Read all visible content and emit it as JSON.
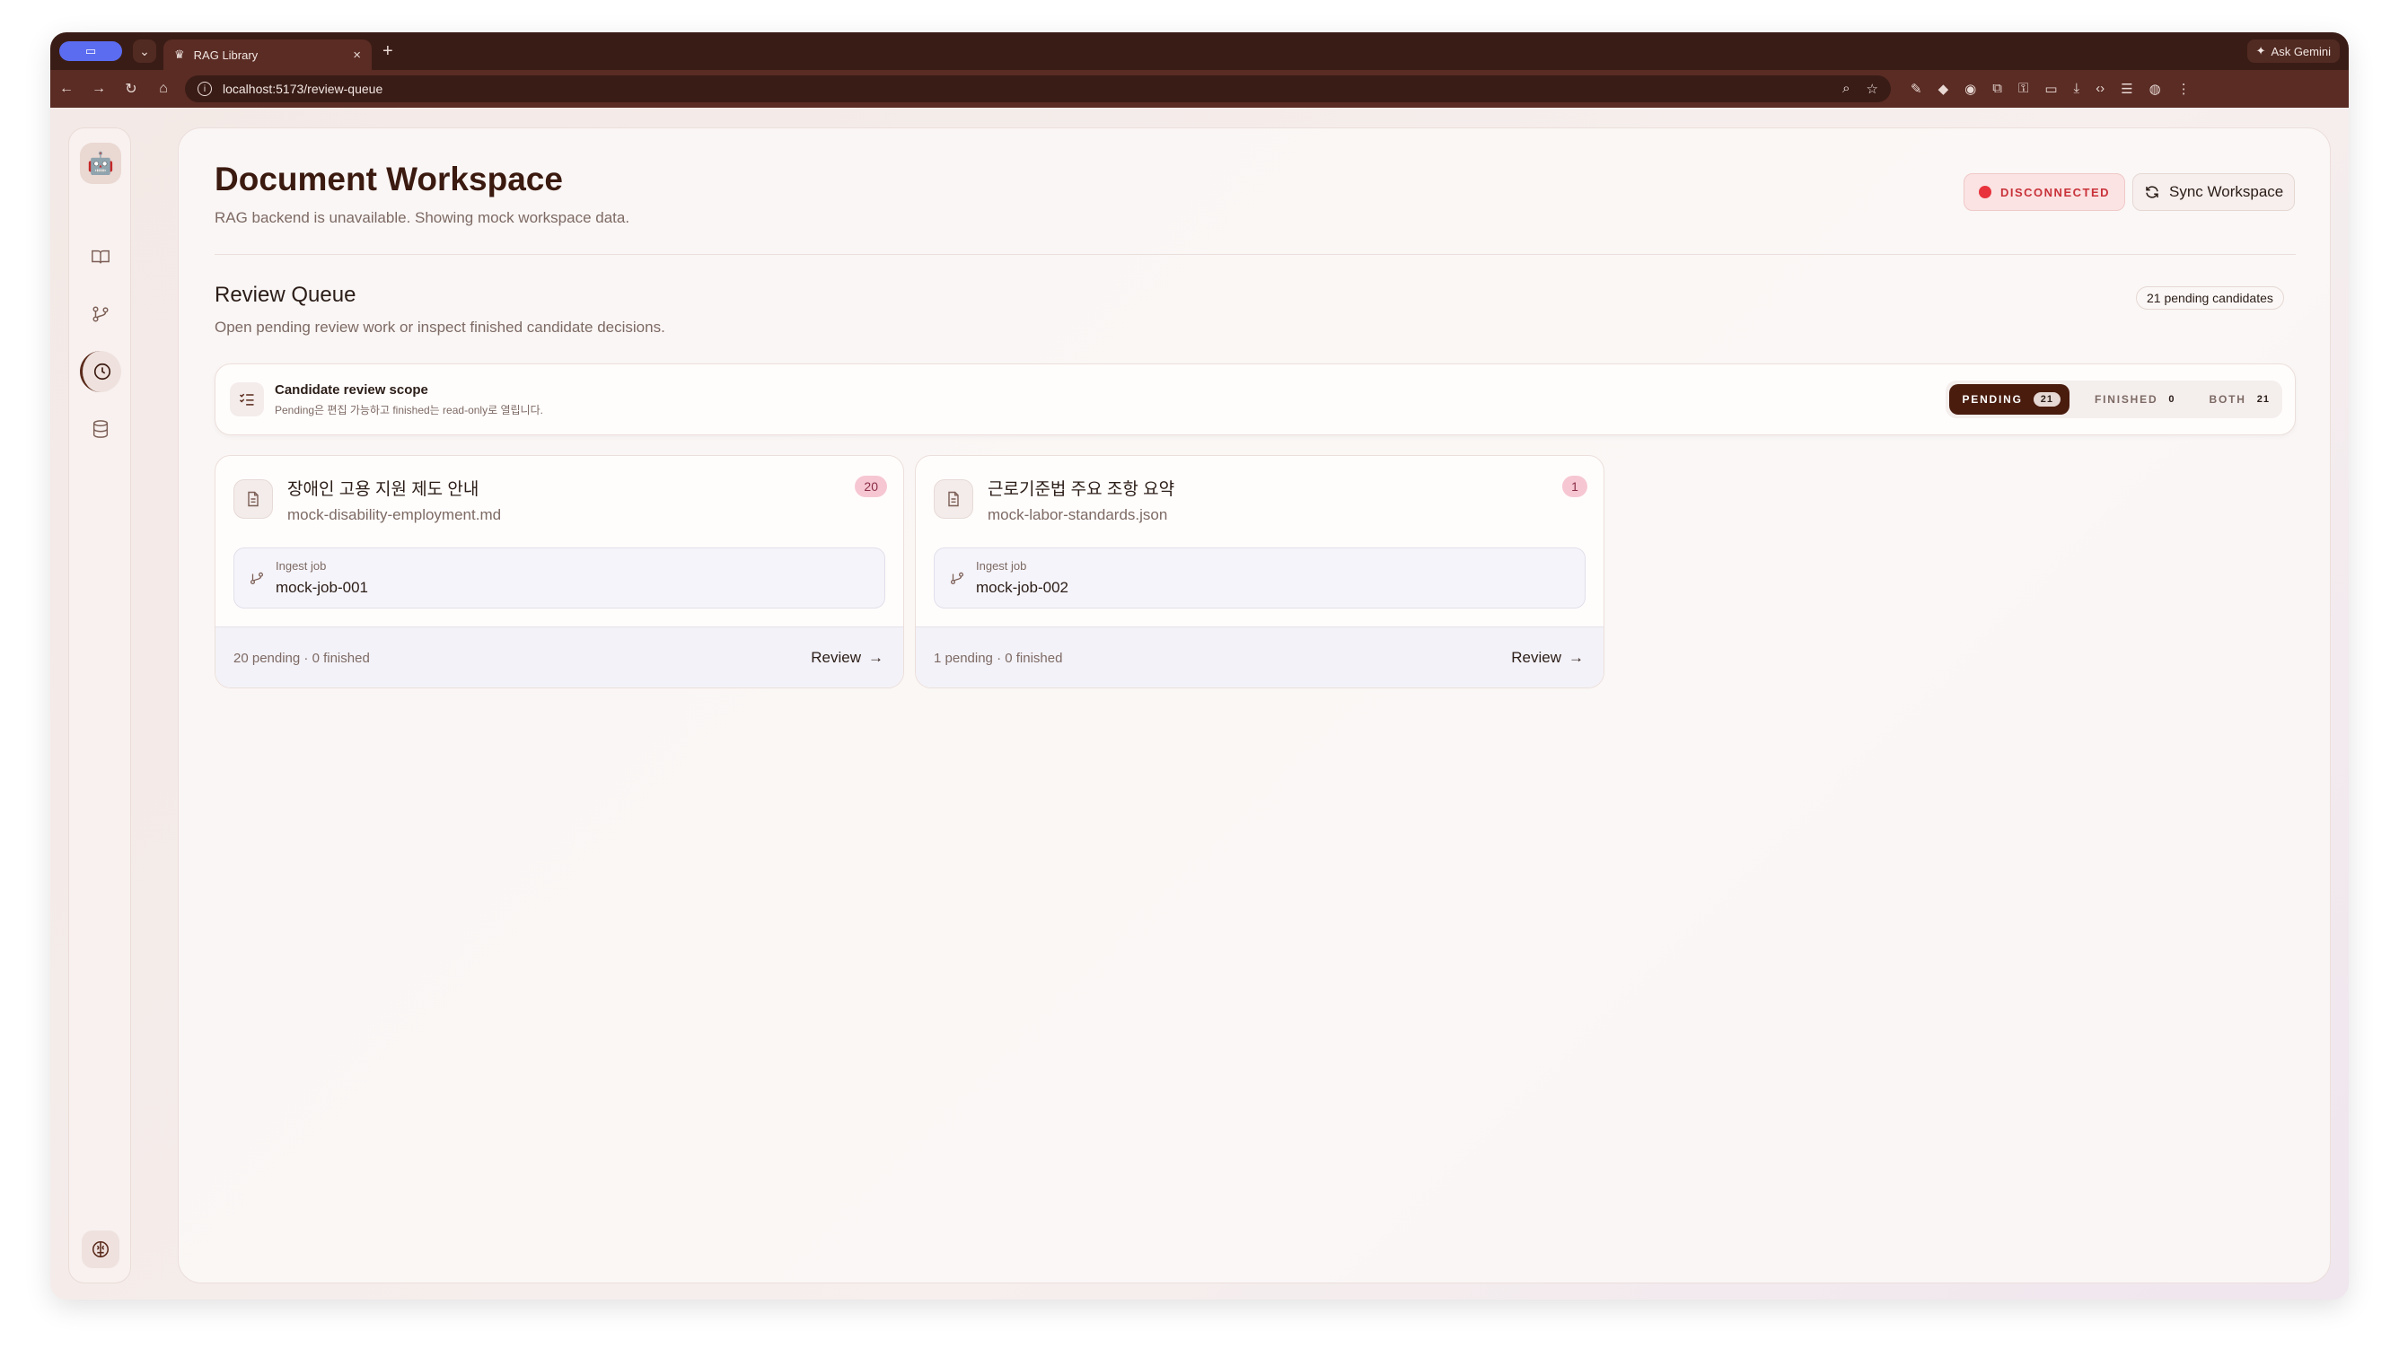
{
  "browser": {
    "tab_title": "RAG Library",
    "ask_gemini": "Ask Gemini",
    "url": "localhost:5173/review-queue"
  },
  "header": {
    "title": "Document Workspace",
    "subtitle": "RAG backend is unavailable. Showing mock workspace data.",
    "status_label": "DISCONNECTED",
    "sync_label": "Sync Workspace"
  },
  "review_queue": {
    "title": "Review Queue",
    "subtitle": "Open pending review work or inspect finished candidate decisions.",
    "pending_pill": "21 pending candidates"
  },
  "scope": {
    "title": "Candidate review scope",
    "subtitle": "Pending은 편집 가능하고 finished는 read-only로 열립니다.",
    "segments": [
      {
        "label": "PENDING",
        "count": "21"
      },
      {
        "label": "FINISHED",
        "count": "0"
      },
      {
        "label": "BOTH",
        "count": "21"
      }
    ]
  },
  "cards": [
    {
      "title": "장애인 고용 지원 제도 안내",
      "file": "mock-disability-employment.md",
      "badge": "20",
      "job_label": "Ingest job",
      "job_id": "mock-job-001",
      "summary": "20 pending · 0 finished",
      "action": "Review"
    },
    {
      "title": "근로기준법 주요 조항 요약",
      "file": "mock-labor-standards.json",
      "badge": "1",
      "job_label": "Ingest job",
      "job_id": "mock-job-002",
      "summary": "1 pending · 0 finished",
      "action": "Review"
    }
  ],
  "icons": {
    "sidebar": [
      "book-open-icon",
      "git-branch-icon",
      "clock-icon",
      "database-icon"
    ],
    "bottom": "brain-icon",
    "avatar": "robot-avatar"
  }
}
